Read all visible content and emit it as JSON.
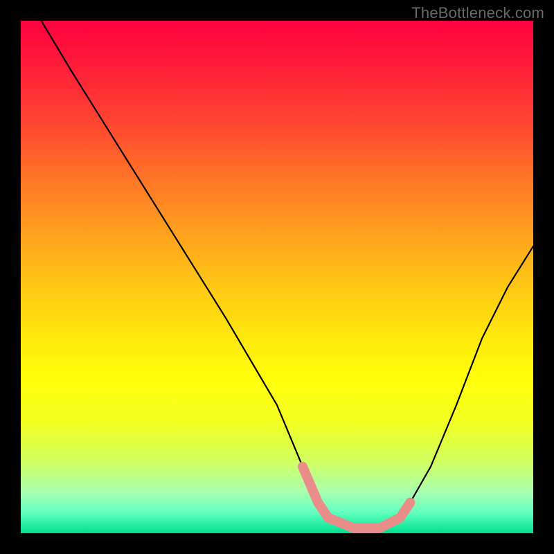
{
  "branding": {
    "text": "TheBottleneck.com"
  },
  "chart_data": {
    "type": "line",
    "title": "",
    "xlabel": "",
    "ylabel": "",
    "xlim": [
      0,
      100
    ],
    "ylim": [
      0,
      100
    ],
    "grid": false,
    "legend": false,
    "series": [
      {
        "name": "curve",
        "color": "#000000",
        "x": [
          4,
          10,
          20,
          30,
          40,
          50,
          55,
          58,
          60,
          65,
          70,
          74,
          76,
          80,
          85,
          90,
          95,
          100
        ],
        "y": [
          100,
          90,
          74,
          58,
          42,
          25,
          13,
          6,
          3,
          1,
          1,
          3,
          6,
          13,
          25,
          38,
          48,
          56
        ]
      }
    ],
    "highlight": {
      "name": "optimal-range",
      "color": "#e98d8a",
      "x": [
        55,
        58,
        60,
        65,
        70,
        74,
        76
      ],
      "y": [
        13,
        6,
        3,
        1,
        1,
        3,
        6
      ]
    }
  }
}
